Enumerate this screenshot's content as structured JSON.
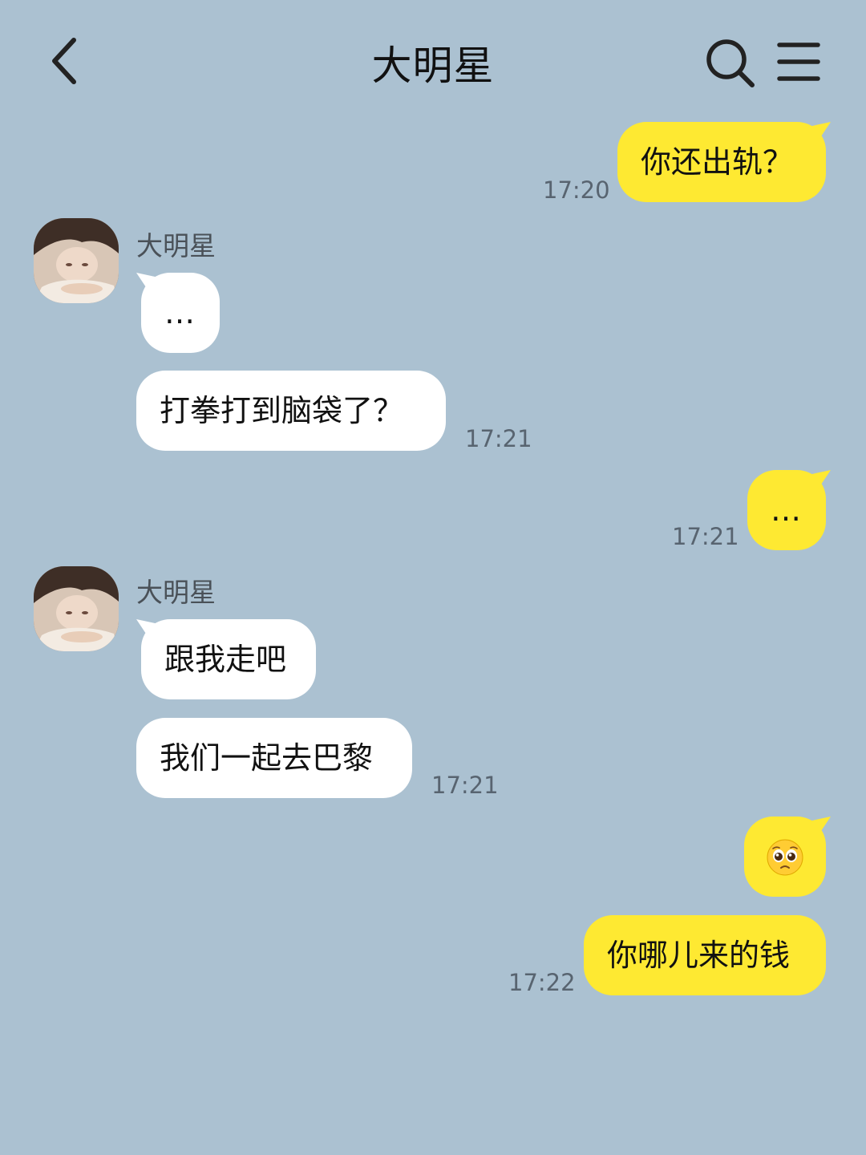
{
  "header": {
    "title": "大明星",
    "back_icon": "chevron-left-icon",
    "search_icon": "search-icon",
    "menu_icon": "hamburger-menu-icon"
  },
  "colors": {
    "background": "#abc1d1",
    "incoming_bubble": "#ffffff",
    "outgoing_bubble": "#fee932",
    "timestamp": "#586470"
  },
  "messages": [
    {
      "direction": "out",
      "text": "你还出轨？",
      "time": "17:20"
    },
    {
      "direction": "in",
      "sender": "大明星",
      "text": "…"
    },
    {
      "direction": "in",
      "text": "打拳打到脑袋了？",
      "time": "17:21"
    },
    {
      "direction": "out",
      "text": "…",
      "time": "17:21"
    },
    {
      "direction": "in",
      "sender": "大明星",
      "text": "跟我走吧"
    },
    {
      "direction": "in",
      "text": "我们一起去巴黎",
      "time": "17:21"
    },
    {
      "direction": "out",
      "emoji": "pleading-face-emoji"
    },
    {
      "direction": "out",
      "text": "你哪儿来的钱",
      "time": "17:22"
    }
  ]
}
